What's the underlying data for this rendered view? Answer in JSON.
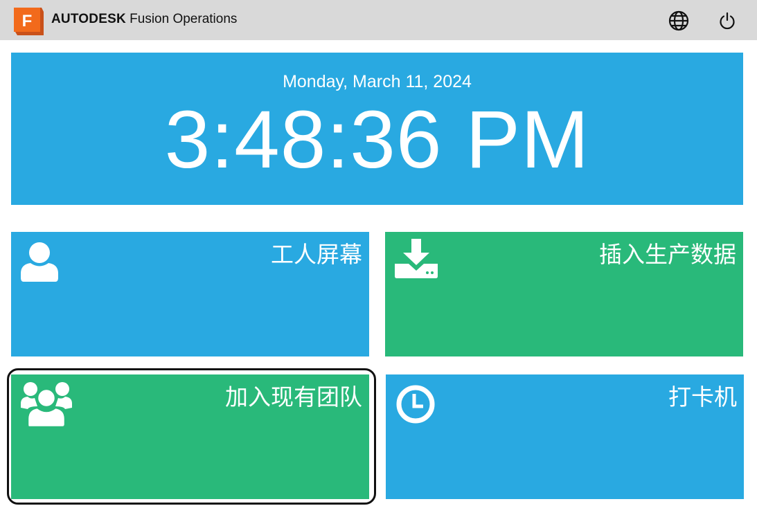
{
  "header": {
    "logo_letter": "F",
    "brand_bold": "AUTODESK",
    "brand_rest": " Fusion Operations",
    "icons": [
      "globe-icon",
      "power-icon"
    ]
  },
  "clock": {
    "date": "Monday, March 11, 2024",
    "time": "3:48:36 PM"
  },
  "tiles": [
    {
      "label": "工人屏幕",
      "icon": "user-icon",
      "color": "#29a9e1"
    },
    {
      "label": "插入生产数据",
      "icon": "download-icon",
      "color": "#29b97a"
    },
    {
      "label": "加入现有团队",
      "icon": "group-icon",
      "color": "#29b97a"
    },
    {
      "label": "打卡机",
      "icon": "clock-icon",
      "color": "#29a9e1"
    }
  ],
  "colors": {
    "header_bg": "#d9d9d9",
    "blue": "#29a9e1",
    "green": "#29b97a",
    "logo_orange": "#f26a1b"
  }
}
